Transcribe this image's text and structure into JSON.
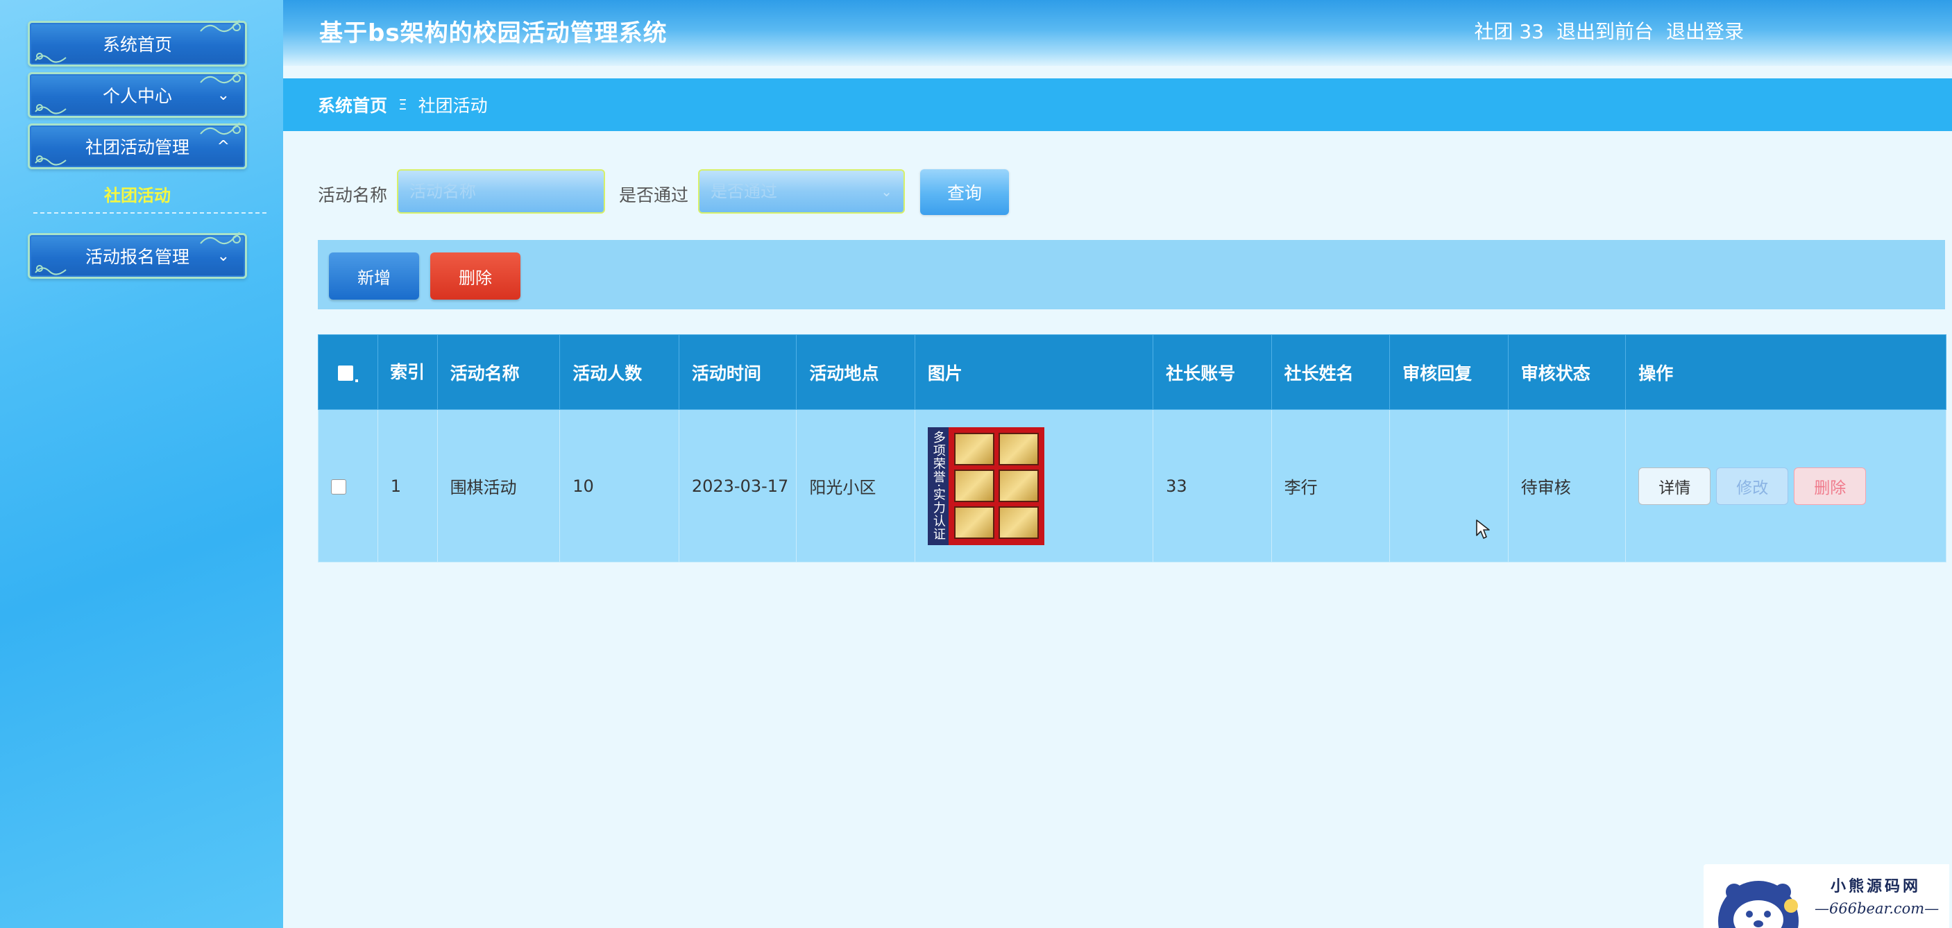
{
  "app": {
    "title": "基于bs架构的校园活动管理系统"
  },
  "header": {
    "user_label": "社团 33",
    "back_to_front": "退出到前台",
    "logout": "退出登录"
  },
  "sidebar": {
    "items": [
      {
        "label": "系统首页"
      },
      {
        "label": "个人中心"
      },
      {
        "label": "社团活动管理"
      },
      {
        "label": "活动报名管理"
      }
    ],
    "active_sub_item": "社团活动"
  },
  "breadcrumb": {
    "home": "系统首页",
    "separator": "Ξ",
    "current": "社团活动"
  },
  "search": {
    "name_label": "活动名称",
    "name_placeholder": "活动名称",
    "pass_label": "是否通过",
    "pass_placeholder": "是否通过",
    "query_button": "查询"
  },
  "toolbar": {
    "add_label": "新增",
    "delete_label": "删除"
  },
  "table": {
    "columns": [
      "索引",
      "活动名称",
      "活动人数",
      "活动时间",
      "活动地点",
      "图片",
      "社长账号",
      "社长姓名",
      "审核回复",
      "审核状态",
      "操作"
    ],
    "rows": [
      {
        "index": "1",
        "name": "围棋活动",
        "count": "10",
        "time": "2023-03-17",
        "location": "阳光小区",
        "image_band_text": "多项荣誉·实力认证",
        "leader_account": "33",
        "leader_name": "李行",
        "review_reply": "",
        "review_status": "待审核",
        "actions": {
          "detail": "详情",
          "edit": "修改",
          "delete": "删除"
        }
      }
    ]
  },
  "watermark": {
    "title": "小熊源码网",
    "url": "—666bear.com—"
  },
  "colors": {
    "sidebar_bg": "#4cbef7",
    "header_bg": "#2f9de8",
    "breadcrumb_bg": "#2cb2f3",
    "table_header_bg": "#1a8ed0",
    "table_row_bg": "#9ddcfb",
    "active_sub_item": "#f4f742",
    "delete_button": "#d93320"
  }
}
